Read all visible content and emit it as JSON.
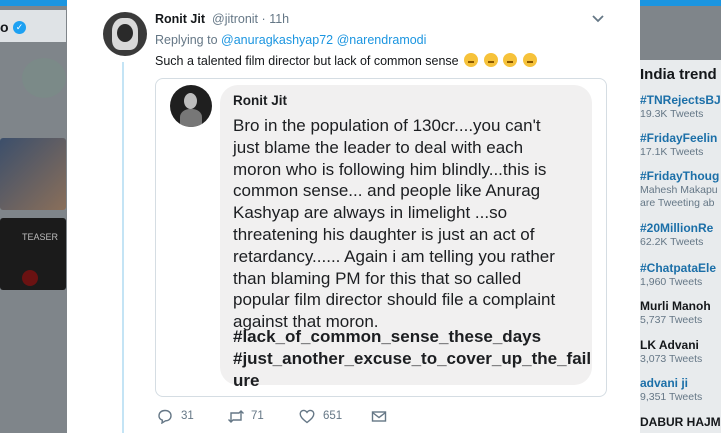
{
  "left": {
    "partial_name": "o"
  },
  "tweet": {
    "author_name": "Ronit Jit",
    "author_handle": "@jitronit",
    "separator": "·",
    "time": "11h",
    "replying_prefix": "Replying to",
    "replying_to": [
      "@anuragkashyap72",
      "@narendramodi"
    ],
    "text": "Such a talented film director but lack of common sense",
    "emoji_count": 4,
    "media": {
      "author": "Ronit Jit",
      "body": "Bro in the population of 130cr....you can't\njust blame the leader to deal with each\nmoron who is following him blindly...this is\ncommon sense... and people like Anurag\nKashyap are always in limelight ...so\nthreatening his daughter is just an act of\nretardancy...... Again i am telling you rather\nthan blaming PM for this that so called\npopular film director should file a complaint\nagainst that moron.",
      "hashtag1": "#lack_of_common_sense_these_days",
      "hashtag2": "#just_another_excuse_to_cover_up_the_fail",
      "hashtag2_wrap": "ure"
    },
    "actions": {
      "reply_count": "31",
      "retweet_count": "71",
      "like_count": "651"
    }
  },
  "sidebar": {
    "title": "India trend",
    "trends": [
      {
        "name": "#TNRejectsBJ",
        "count": "19.3K Tweets"
      },
      {
        "name": "#FridayFeelin",
        "count": "17.1K Tweets"
      },
      {
        "name": "#FridayThoug",
        "count": "Mahesh Makapu",
        "extra": "are Tweeting ab"
      },
      {
        "name": "#20MillionRe",
        "count": "62.2K Tweets"
      },
      {
        "name": "#ChatpataEle",
        "count": "1,960 Tweets"
      },
      {
        "name": "Murli Manoh",
        "count": "5,737 Tweets"
      },
      {
        "name": "LK Advani",
        "count": "3,073 Tweets"
      },
      {
        "name": "advani ji",
        "count": "9,351 Tweets"
      },
      {
        "name": "DABUR HAJM",
        "count": ""
      }
    ]
  },
  "colors": {
    "accent": "#1b95e0",
    "link": "#1b95e0",
    "muted": "#657786",
    "text": "#14171a",
    "bubble": "#f1f0f0"
  }
}
